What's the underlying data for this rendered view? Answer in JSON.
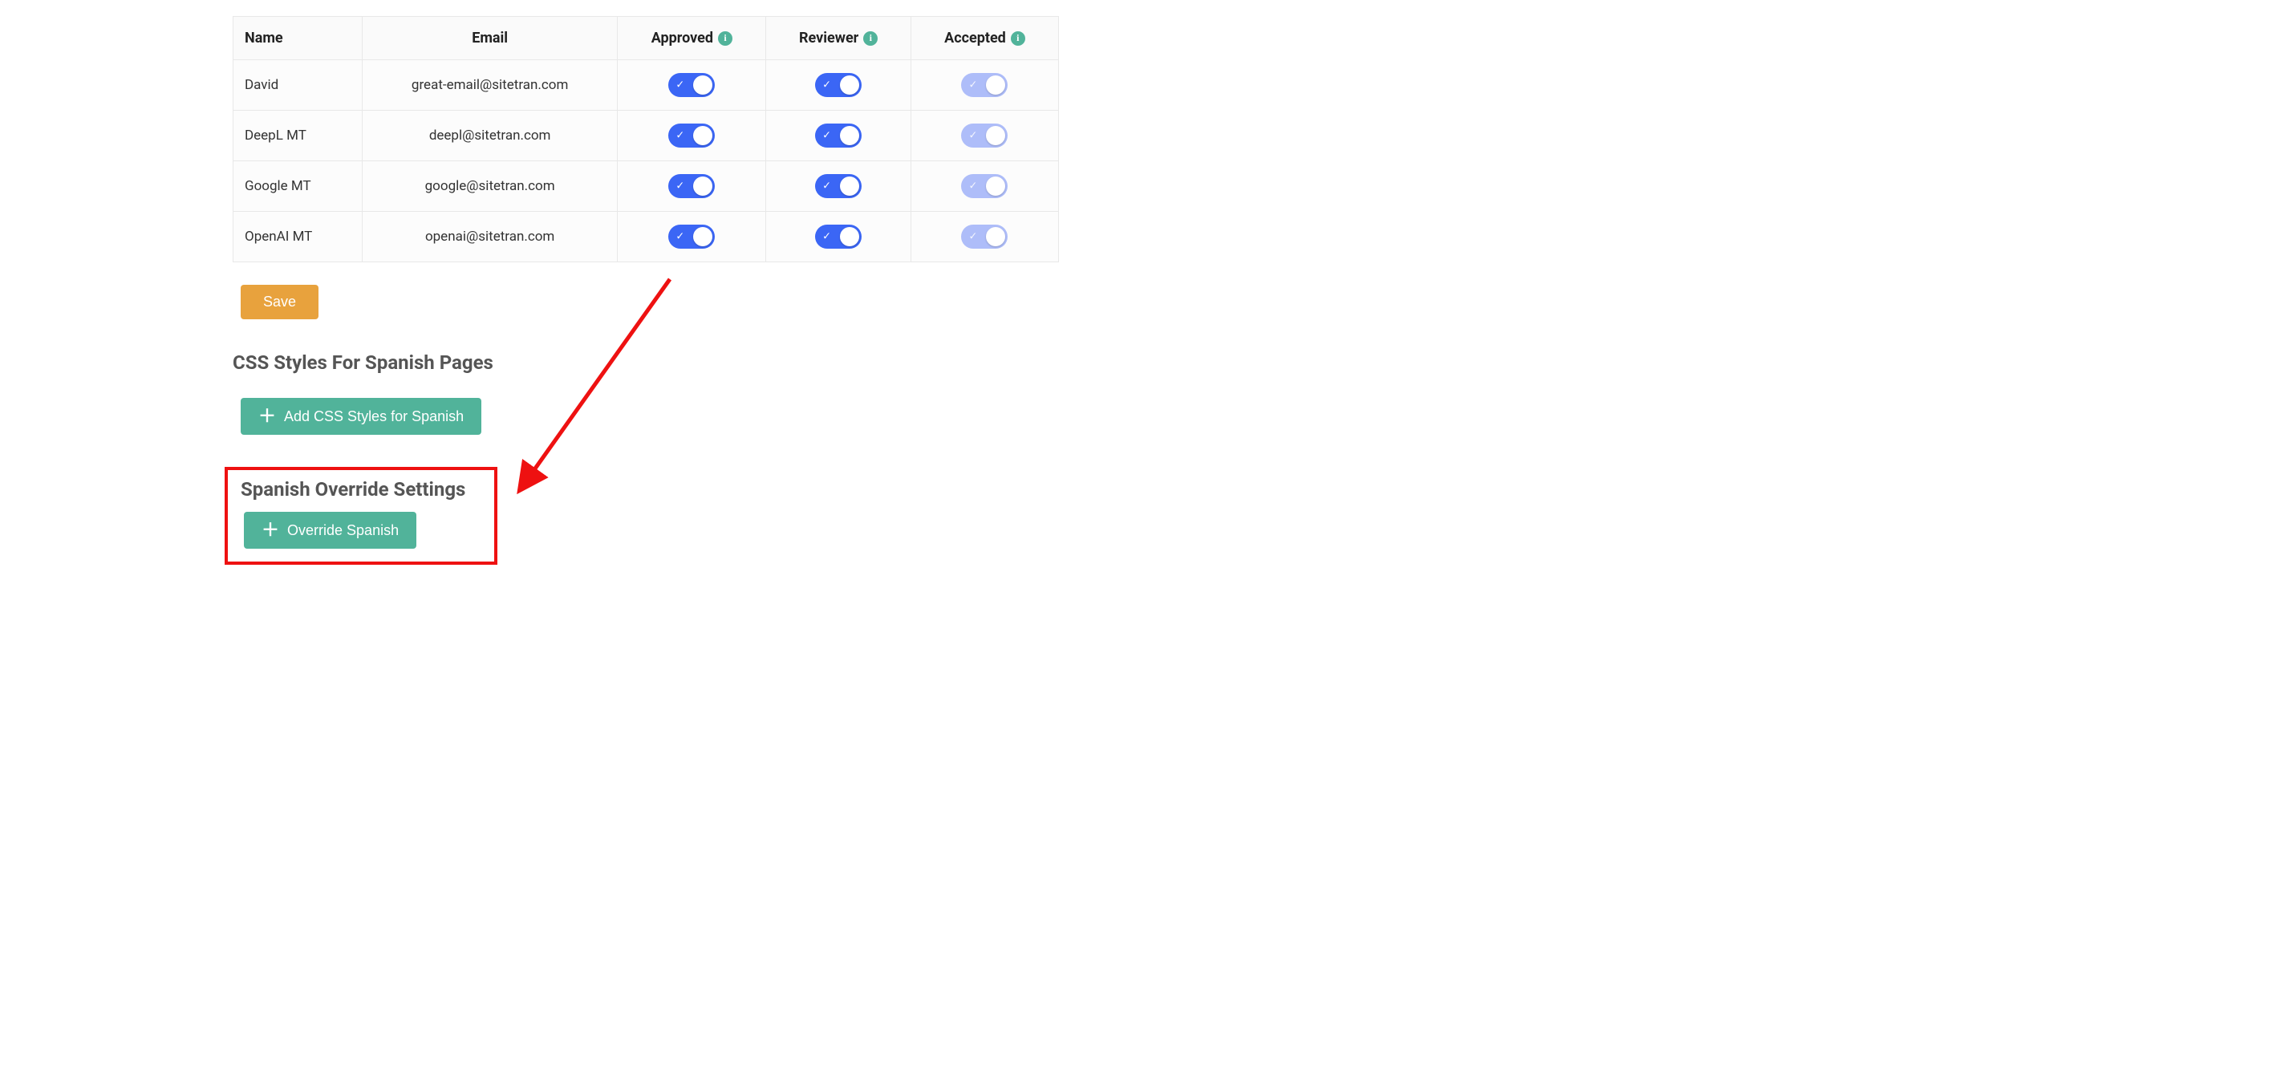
{
  "table": {
    "headers": {
      "name": "Name",
      "email": "Email",
      "approved": "Approved",
      "reviewer": "Reviewer",
      "accepted": "Accepted"
    },
    "rows": [
      {
        "name": "David",
        "email": "great-email@sitetran.com",
        "approved": true,
        "reviewer": true,
        "accepted_disabled": true
      },
      {
        "name": "DeepL MT",
        "email": "deepl@sitetran.com",
        "approved": true,
        "reviewer": true,
        "accepted_disabled": true
      },
      {
        "name": "Google MT",
        "email": "google@sitetran.com",
        "approved": true,
        "reviewer": true,
        "accepted_disabled": true
      },
      {
        "name": "OpenAI MT",
        "email": "openai@sitetran.com",
        "approved": true,
        "reviewer": true,
        "accepted_disabled": true
      }
    ]
  },
  "buttons": {
    "save": "Save",
    "add_css": "Add CSS Styles for Spanish",
    "override": "Override Spanish"
  },
  "sections": {
    "css_heading": "CSS Styles For Spanish Pages",
    "override_heading": "Spanish Override Settings"
  }
}
